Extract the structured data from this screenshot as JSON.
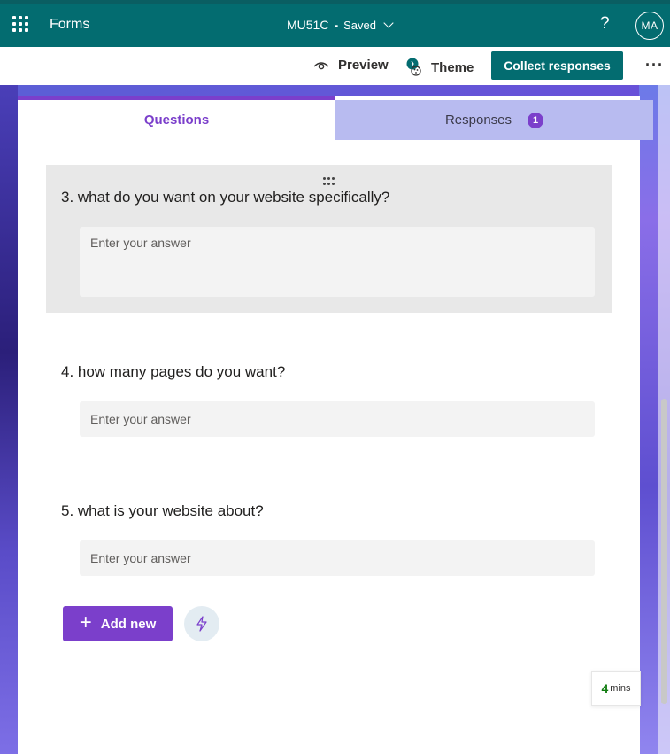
{
  "appbar": {
    "app_name": "Forms",
    "doc_title": "MU51C",
    "separator": "-",
    "status": "Saved",
    "help": "?",
    "avatar_initials": "MA"
  },
  "commands": {
    "preview_label": "Preview",
    "theme_label": "Theme",
    "collect_label": "Collect responses",
    "more_label": "···"
  },
  "tabs": {
    "questions_label": "Questions",
    "responses_label": "Responses",
    "responses_count": "1"
  },
  "questions": [
    {
      "title": "3. what do you want on your website specifically?",
      "placeholder": "Enter your answer"
    },
    {
      "title": "4. how many pages do you want?",
      "placeholder": "Enter your answer"
    },
    {
      "title": "5. what is your website about?",
      "placeholder": "Enter your answer"
    }
  ],
  "actions": {
    "add_new_label": "Add new"
  },
  "time_estimate": {
    "value": "4",
    "unit": "mins"
  },
  "colors": {
    "appbar": "#036c70",
    "accent": "#7b3fcb",
    "collect_button": "#036c70"
  },
  "icons": [
    "waffle-icon",
    "chevron-down-icon",
    "help-icon",
    "eye-icon",
    "palette-icon",
    "more-icon",
    "drag-handle-icon",
    "plus-icon",
    "lightning-icon"
  ]
}
